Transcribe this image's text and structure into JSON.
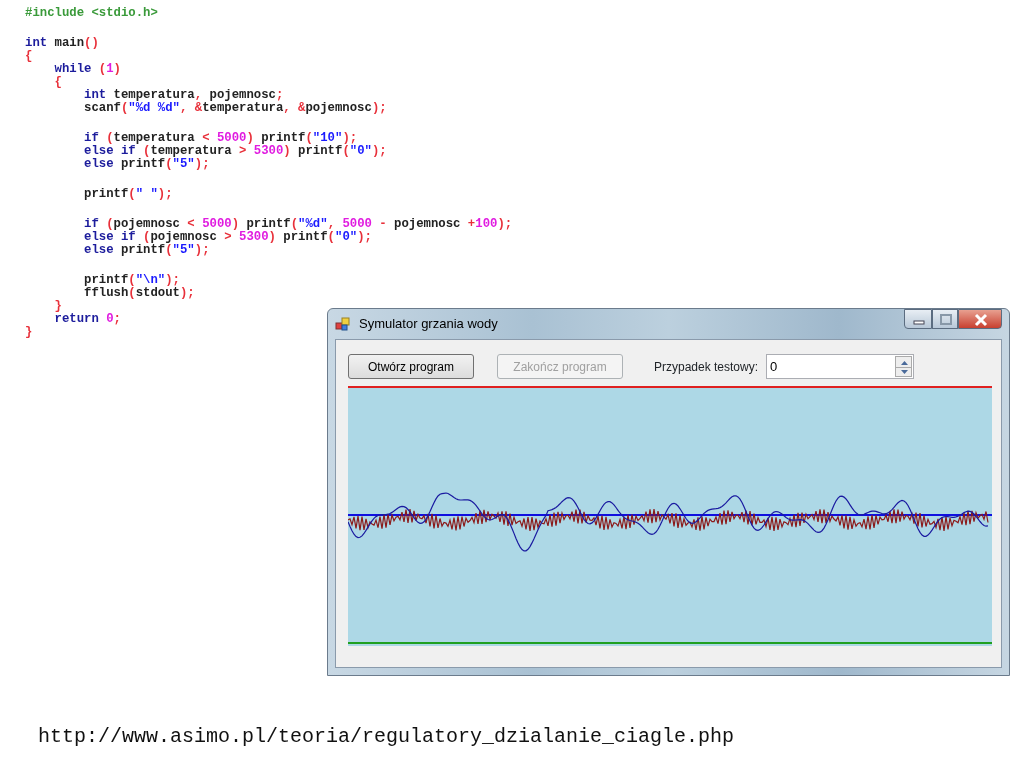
{
  "code_blocks": [
    [
      [
        {
          "kind": "pp",
          "text": "#include <stdio.h>"
        }
      ]
    ],
    [
      [
        {
          "kind": "kw",
          "text": "int"
        },
        {
          "kind": "id",
          "text": " main"
        },
        {
          "kind": "op",
          "text": "()"
        }
      ],
      [
        {
          "kind": "op",
          "text": "{"
        }
      ],
      [
        {
          "kind": "kw",
          "text": "    while"
        },
        {
          "kind": "op",
          "text": " ("
        },
        {
          "kind": "num",
          "text": "1"
        },
        {
          "kind": "op",
          "text": ")"
        }
      ],
      [
        {
          "kind": "op",
          "text": "    {"
        }
      ],
      [
        {
          "kind": "kw",
          "text": "        int"
        },
        {
          "kind": "id",
          "text": " temperatura"
        },
        {
          "kind": "op",
          "text": ","
        },
        {
          "kind": "id",
          "text": " pojemnosc"
        },
        {
          "kind": "op",
          "text": ";"
        }
      ],
      [
        {
          "kind": "id",
          "text": "        scanf"
        },
        {
          "kind": "op",
          "text": "("
        },
        {
          "kind": "str",
          "text": "\"%d %d\""
        },
        {
          "kind": "op",
          "text": ", &"
        },
        {
          "kind": "id",
          "text": "temperatura"
        },
        {
          "kind": "op",
          "text": ", &"
        },
        {
          "kind": "id",
          "text": "pojemnosc"
        },
        {
          "kind": "op",
          "text": ");"
        }
      ]
    ],
    [
      [
        {
          "kind": "kw",
          "text": "        if"
        },
        {
          "kind": "op",
          "text": " ("
        },
        {
          "kind": "id",
          "text": "temperatura"
        },
        {
          "kind": "op",
          "text": " < "
        },
        {
          "kind": "num",
          "text": "5000"
        },
        {
          "kind": "op",
          "text": ")"
        },
        {
          "kind": "id",
          "text": " printf"
        },
        {
          "kind": "op",
          "text": "("
        },
        {
          "kind": "str",
          "text": "\"10\""
        },
        {
          "kind": "op",
          "text": ");"
        }
      ],
      [
        {
          "kind": "kw",
          "text": "        else if"
        },
        {
          "kind": "op",
          "text": " ("
        },
        {
          "kind": "id",
          "text": "temperatura"
        },
        {
          "kind": "op",
          "text": " > "
        },
        {
          "kind": "num",
          "text": "5300"
        },
        {
          "kind": "op",
          "text": ")"
        },
        {
          "kind": "id",
          "text": " printf"
        },
        {
          "kind": "op",
          "text": "("
        },
        {
          "kind": "str",
          "text": "\"0\""
        },
        {
          "kind": "op",
          "text": ");"
        }
      ],
      [
        {
          "kind": "kw",
          "text": "        else"
        },
        {
          "kind": "id",
          "text": " printf"
        },
        {
          "kind": "op",
          "text": "("
        },
        {
          "kind": "str",
          "text": "\"5\""
        },
        {
          "kind": "op",
          "text": ");"
        }
      ]
    ],
    [
      [
        {
          "kind": "id",
          "text": "        printf"
        },
        {
          "kind": "op",
          "text": "("
        },
        {
          "kind": "str",
          "text": "\" \""
        },
        {
          "kind": "op",
          "text": ");"
        }
      ]
    ],
    [
      [
        {
          "kind": "kw",
          "text": "        if"
        },
        {
          "kind": "op",
          "text": " ("
        },
        {
          "kind": "id",
          "text": "pojemnosc"
        },
        {
          "kind": "op",
          "text": " < "
        },
        {
          "kind": "num",
          "text": "5000"
        },
        {
          "kind": "op",
          "text": ")"
        },
        {
          "kind": "id",
          "text": " printf"
        },
        {
          "kind": "op",
          "text": "("
        },
        {
          "kind": "str",
          "text": "\"%d\""
        },
        {
          "kind": "op",
          "text": ", "
        },
        {
          "kind": "num",
          "text": "5000"
        },
        {
          "kind": "op",
          "text": " - "
        },
        {
          "kind": "id",
          "text": "pojemnosc"
        },
        {
          "kind": "op",
          "text": " +"
        },
        {
          "kind": "num",
          "text": "100"
        },
        {
          "kind": "op",
          "text": ");"
        }
      ],
      [
        {
          "kind": "kw",
          "text": "        else if"
        },
        {
          "kind": "op",
          "text": " ("
        },
        {
          "kind": "id",
          "text": "pojemnosc"
        },
        {
          "kind": "op",
          "text": " > "
        },
        {
          "kind": "num",
          "text": "5300"
        },
        {
          "kind": "op",
          "text": ")"
        },
        {
          "kind": "id",
          "text": " printf"
        },
        {
          "kind": "op",
          "text": "("
        },
        {
          "kind": "str",
          "text": "\"0\""
        },
        {
          "kind": "op",
          "text": ");"
        }
      ],
      [
        {
          "kind": "kw",
          "text": "        else"
        },
        {
          "kind": "id",
          "text": " printf"
        },
        {
          "kind": "op",
          "text": "("
        },
        {
          "kind": "str",
          "text": "\"5\""
        },
        {
          "kind": "op",
          "text": ");"
        }
      ]
    ],
    [
      [
        {
          "kind": "id",
          "text": "        printf"
        },
        {
          "kind": "op",
          "text": "("
        },
        {
          "kind": "str",
          "text": "\"\\n\""
        },
        {
          "kind": "op",
          "text": ");"
        }
      ],
      [
        {
          "kind": "id",
          "text": "        fflush"
        },
        {
          "kind": "op",
          "text": "("
        },
        {
          "kind": "id",
          "text": "stdout"
        },
        {
          "kind": "op",
          "text": ");"
        }
      ],
      [
        {
          "kind": "op",
          "text": "    }"
        }
      ],
      [
        {
          "kind": "kw",
          "text": "    return"
        },
        {
          "kind": "num",
          "text": " 0"
        },
        {
          "kind": "op",
          "text": ";"
        }
      ],
      [
        {
          "kind": "op",
          "text": "}"
        }
      ]
    ]
  ],
  "window": {
    "title": "Symulator grzania wody",
    "buttons": [
      {
        "label": "Otwórz program",
        "disabled": false
      },
      {
        "label": "Zakończ program",
        "disabled": true
      }
    ],
    "test_case": {
      "label": "Przypadek testowy:",
      "value": "0"
    }
  },
  "url": "http://www.asimo.pl/teoria/regulatory_dzialanie_ciagle.php"
}
